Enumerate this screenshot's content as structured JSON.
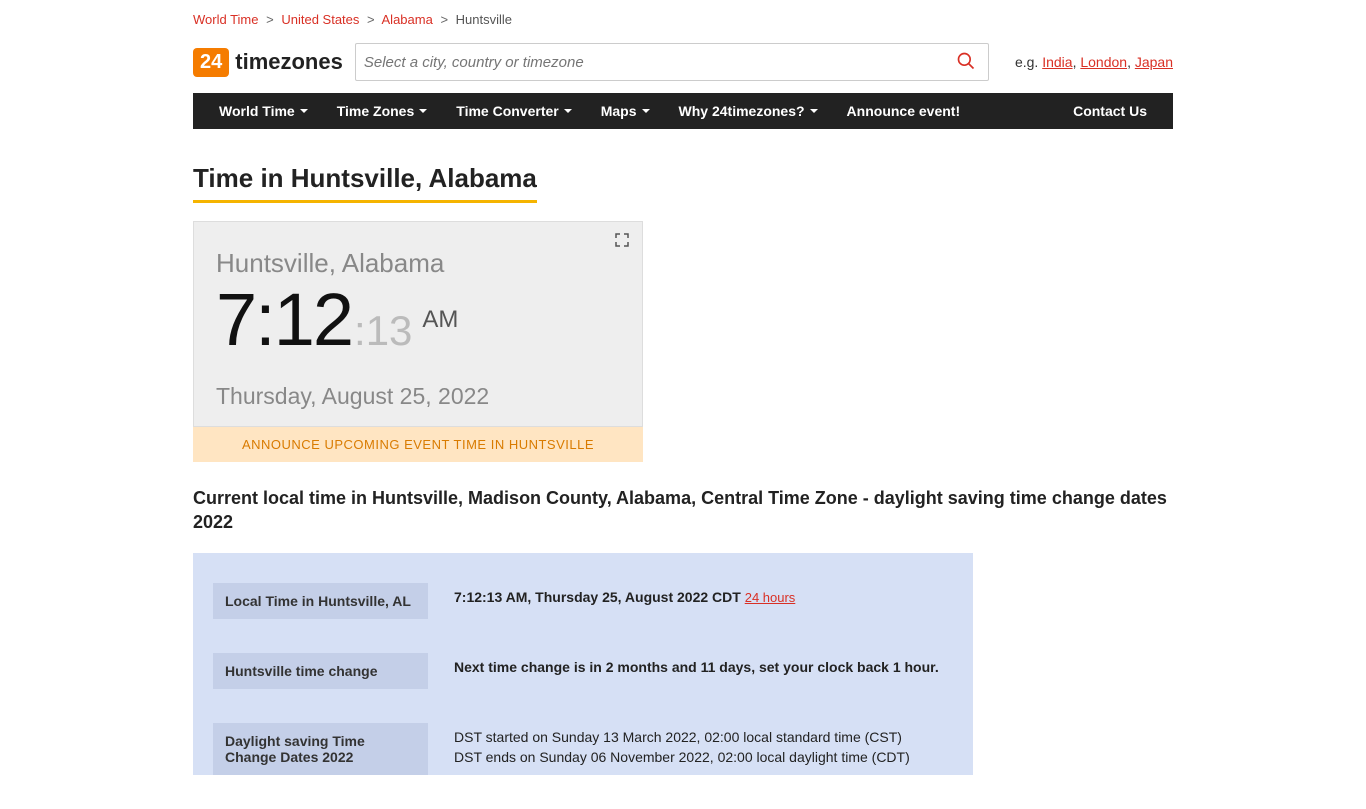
{
  "breadcrumb": {
    "items": [
      "World Time",
      "United States",
      "Alabama"
    ],
    "current": "Huntsville"
  },
  "logo": {
    "badge": "24",
    "text": "timezones"
  },
  "search": {
    "placeholder": "Select a city, country or timezone"
  },
  "examples": {
    "prefix": "e.g. ",
    "links": [
      "India",
      "London",
      "Japan"
    ]
  },
  "nav": {
    "items": [
      "World Time",
      "Time Zones",
      "Time Converter",
      "Maps",
      "Why 24timezones?",
      "Announce event!"
    ],
    "contact": "Contact Us"
  },
  "page_title": "Time in Huntsville, Alabama",
  "clock": {
    "city": "Huntsville, Alabama",
    "hm": "7:12",
    "sec": ":13",
    "ampm": "AM",
    "date": "Thursday, August 25, 2022"
  },
  "announce": "ANNOUNCE UPCOMING EVENT TIME IN HUNTSVILLE",
  "subheading": "Current local time in Huntsville, Madison County, Alabama, Central Time Zone - daylight saving time change dates 2022",
  "info": {
    "rows": [
      {
        "label": "Local Time in Huntsville, AL",
        "bold": "7:12:13 AM, Thursday 25, August 2022 CDT",
        "link": "24 hours"
      },
      {
        "label": "Huntsville time change",
        "bold": "Next time change is in 2 months and 11 days, set your clock back 1 hour."
      },
      {
        "label": "Daylight saving Time Change Dates 2022",
        "lines": [
          "DST started on Sunday 13 March 2022, 02:00 local standard time (CST)",
          "DST ends on Sunday 06 November 2022, 02:00 local daylight time (CDT)"
        ]
      }
    ]
  }
}
